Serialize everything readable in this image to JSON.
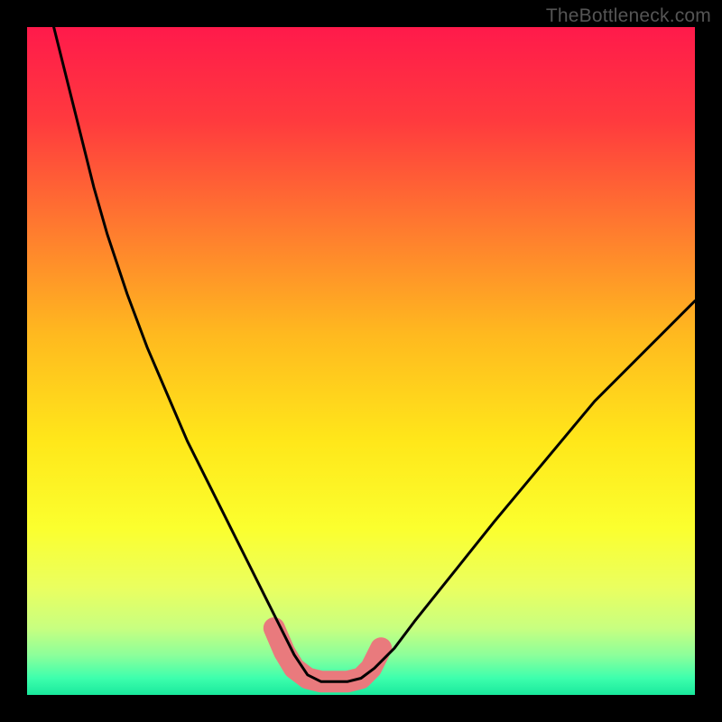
{
  "watermark": "TheBottleneck.com",
  "chart_data": {
    "type": "line",
    "title": "",
    "xlabel": "",
    "ylabel": "",
    "xlim": [
      0,
      100
    ],
    "ylim": [
      0,
      100
    ],
    "note": "Bottleneck curve: a V-shaped mismatch function over a red→yellow→green vertical gradient. Minimum (optimal match) around x≈40–50. Left branch rises to ~100 at x≈4; right branch rises to ~59 at x=100. Values estimated from pixels.",
    "series": [
      {
        "name": "bottleneck_curve",
        "x": [
          4,
          6,
          8,
          10,
          12,
          15,
          18,
          21,
          24,
          27,
          30,
          33,
          36,
          38,
          40,
          42,
          44,
          46,
          48,
          50,
          52,
          55,
          58,
          62,
          66,
          70,
          75,
          80,
          85,
          90,
          95,
          100
        ],
        "y": [
          100,
          92,
          84,
          76,
          69,
          60,
          52,
          45,
          38,
          32,
          26,
          20,
          14,
          10,
          6,
          3,
          2,
          2,
          2,
          2.5,
          4,
          7,
          11,
          16,
          21,
          26,
          32,
          38,
          44,
          49,
          54,
          59
        ]
      }
    ],
    "highlight_region": {
      "note": "Thick salmon-colored marker near curve bottom",
      "points_x": [
        37,
        38.5,
        40,
        42,
        44,
        46,
        48,
        50,
        51.5,
        53
      ],
      "points_y": [
        10,
        6.5,
        4,
        2.5,
        2,
        2,
        2,
        2.5,
        4,
        7
      ]
    },
    "gradient_stops": [
      {
        "offset": 0.0,
        "color": "#ff1a4b"
      },
      {
        "offset": 0.14,
        "color": "#ff3a3e"
      },
      {
        "offset": 0.3,
        "color": "#ff7a2f"
      },
      {
        "offset": 0.46,
        "color": "#ffb91f"
      },
      {
        "offset": 0.62,
        "color": "#ffe71a"
      },
      {
        "offset": 0.75,
        "color": "#fbff2e"
      },
      {
        "offset": 0.84,
        "color": "#eaff60"
      },
      {
        "offset": 0.9,
        "color": "#c8ff80"
      },
      {
        "offset": 0.94,
        "color": "#8dff9a"
      },
      {
        "offset": 0.975,
        "color": "#3dffad"
      },
      {
        "offset": 1.0,
        "color": "#19e89c"
      }
    ]
  }
}
